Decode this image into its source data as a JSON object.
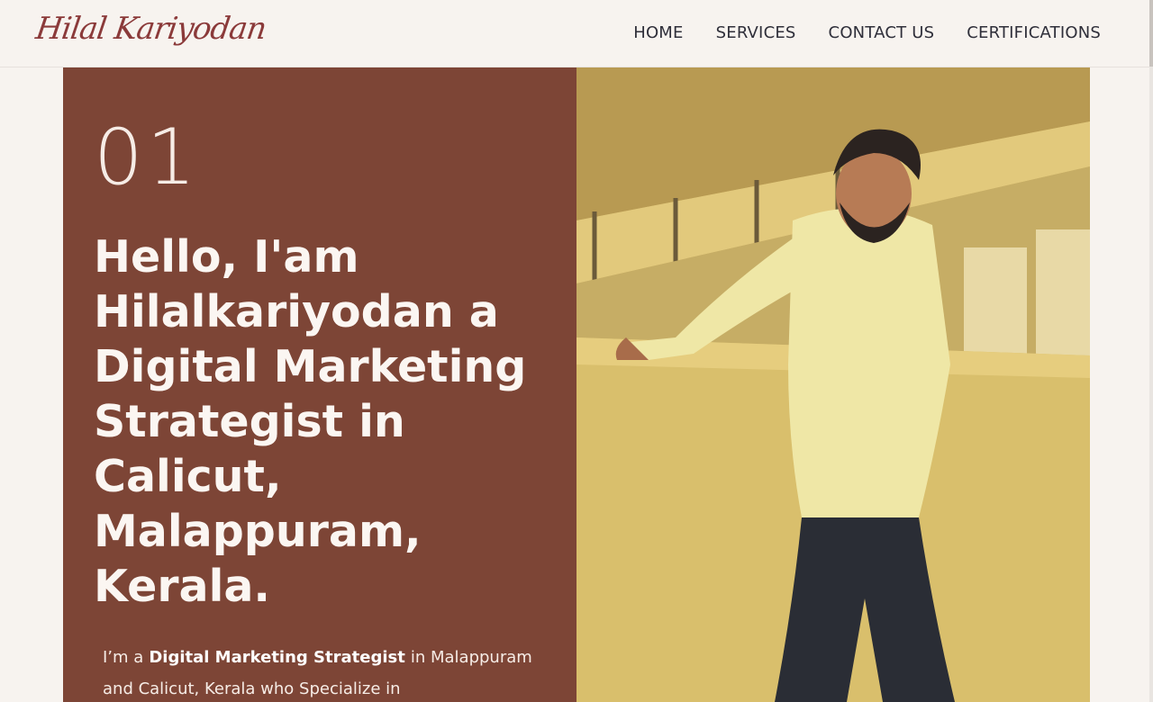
{
  "header": {
    "logo_text": "Hilal Kariyodan",
    "nav": [
      {
        "label": "HOME"
      },
      {
        "label": "SERVICES"
      },
      {
        "label": "CONTACT US"
      },
      {
        "label": "CERTIFICATIONS"
      }
    ]
  },
  "hero": {
    "number": "01",
    "headline": "Hello, I'am Hilalkariyodan a Digital Marketing Strategist in Calicut, Malappuram, Kerala.",
    "intro_prefix": "I’m a",
    "intro_strong": "Digital Marketing Strategist",
    "intro_suffix": "in Malappuram and Calicut, Kerala who Specialize in"
  },
  "colors": {
    "panel": "#7d4536",
    "background": "#f7f3ef",
    "logo": "#8b3a3a",
    "nav_text": "#2f2f3a"
  }
}
